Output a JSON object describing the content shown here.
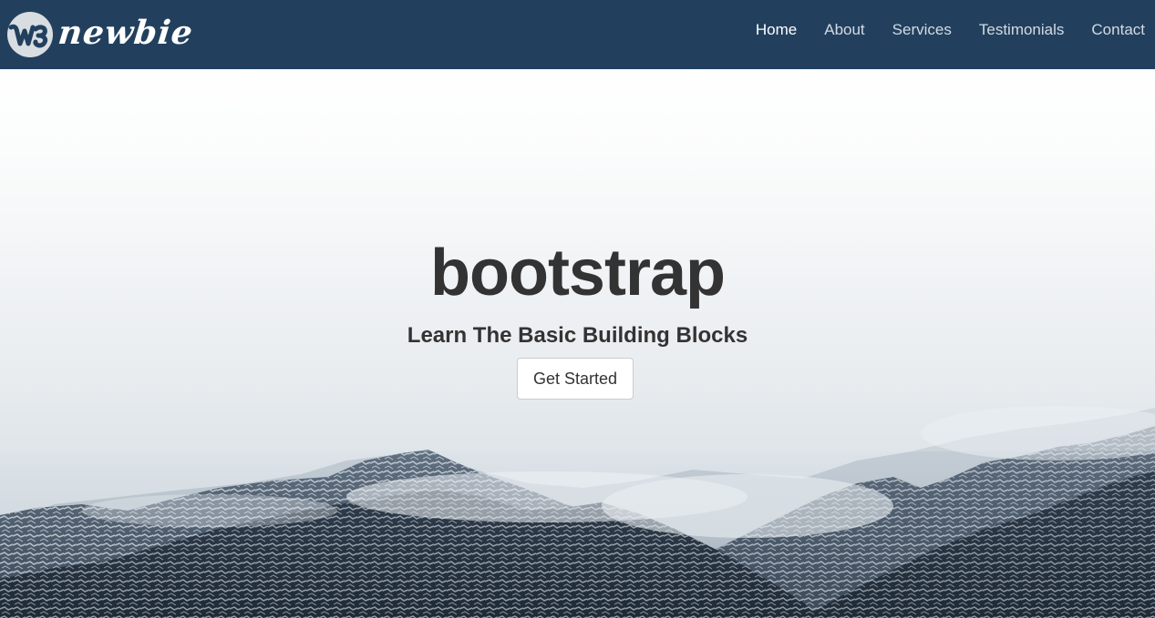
{
  "navbar": {
    "brand_text": "newbie",
    "brand_mark_text": "W3",
    "links": [
      {
        "label": "Home",
        "active": true
      },
      {
        "label": "About",
        "active": false
      },
      {
        "label": "Services",
        "active": false
      },
      {
        "label": "Testimonials",
        "active": false
      },
      {
        "label": "Contact",
        "active": false
      }
    ]
  },
  "hero": {
    "title": "bootstrap",
    "subtitle": "Learn The Basic Building Blocks",
    "cta_label": "Get Started"
  },
  "colors": {
    "navbar_bg": "#22405e",
    "nav_link": "#d3dae2",
    "nav_link_active": "#ffffff",
    "hero_text": "#333333"
  },
  "icons": {
    "brand_logo": "newbie-logo-icon"
  }
}
